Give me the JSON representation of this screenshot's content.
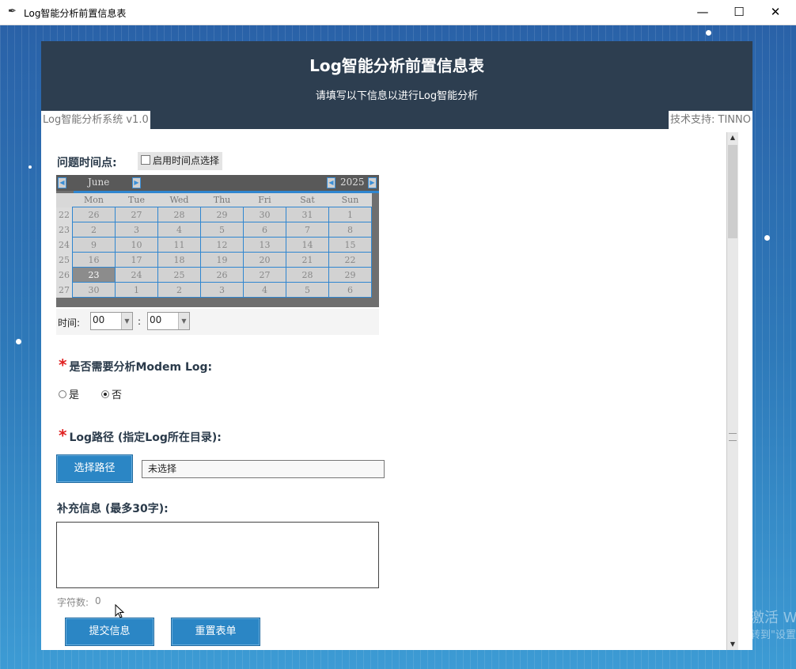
{
  "window": {
    "title": "Log智能分析前置信息表",
    "icon": "feather-icon",
    "minimize": "—",
    "maximize": "☐",
    "close": "✕"
  },
  "header": {
    "title": "Log智能分析前置信息表",
    "subtitle": "请填写以下信息以进行Log智能分析",
    "version": "Log智能分析系统 v1.0",
    "support": "技术支持: TINNO"
  },
  "form": {
    "time_label": "问题时间点:",
    "enable_time_checkbox": {
      "label": "启用时间点选择",
      "checked": false
    },
    "calendar": {
      "month": "June",
      "year": "2025",
      "weekdays": [
        "Mon",
        "Tue",
        "Wed",
        "Thu",
        "Fri",
        "Sat",
        "Sun"
      ],
      "weeks": [
        {
          "week": "22",
          "days": [
            "26",
            "27",
            "28",
            "29",
            "30",
            "31",
            "1"
          ]
        },
        {
          "week": "23",
          "days": [
            "2",
            "3",
            "4",
            "5",
            "6",
            "7",
            "8"
          ]
        },
        {
          "week": "24",
          "days": [
            "9",
            "10",
            "11",
            "12",
            "13",
            "14",
            "15"
          ]
        },
        {
          "week": "25",
          "days": [
            "16",
            "17",
            "18",
            "19",
            "20",
            "21",
            "22"
          ]
        },
        {
          "week": "26",
          "days": [
            "23",
            "24",
            "25",
            "26",
            "27",
            "28",
            "29"
          ]
        },
        {
          "week": "27",
          "days": [
            "30",
            "1",
            "2",
            "3",
            "4",
            "5",
            "6"
          ]
        }
      ],
      "selected_day": "23"
    },
    "time": {
      "label": "时间:",
      "hour": "00",
      "minute": "00",
      "separator": ":"
    },
    "modem": {
      "required_mark": "*",
      "label": "是否需要分析Modem Log:",
      "options": [
        {
          "label": "是",
          "selected": false
        },
        {
          "label": "否",
          "selected": true
        }
      ]
    },
    "log_path": {
      "required_mark": "*",
      "label": "Log路径 (指定Log所在目录):",
      "button": "选择路径",
      "value": "未选择"
    },
    "extra": {
      "label": "补充信息 (最多30字):",
      "value": "",
      "count_label": "字符数:",
      "count": "0"
    },
    "submit_button": "提交信息",
    "reset_button": "重置表单"
  },
  "watermark": {
    "line1": "激活 W",
    "line2": "转到\"设置\""
  },
  "colors": {
    "header_bg": "#2d3e50",
    "accent": "#2b86c5",
    "required": "#e02020",
    "calendar_border": "#2f86d0"
  }
}
